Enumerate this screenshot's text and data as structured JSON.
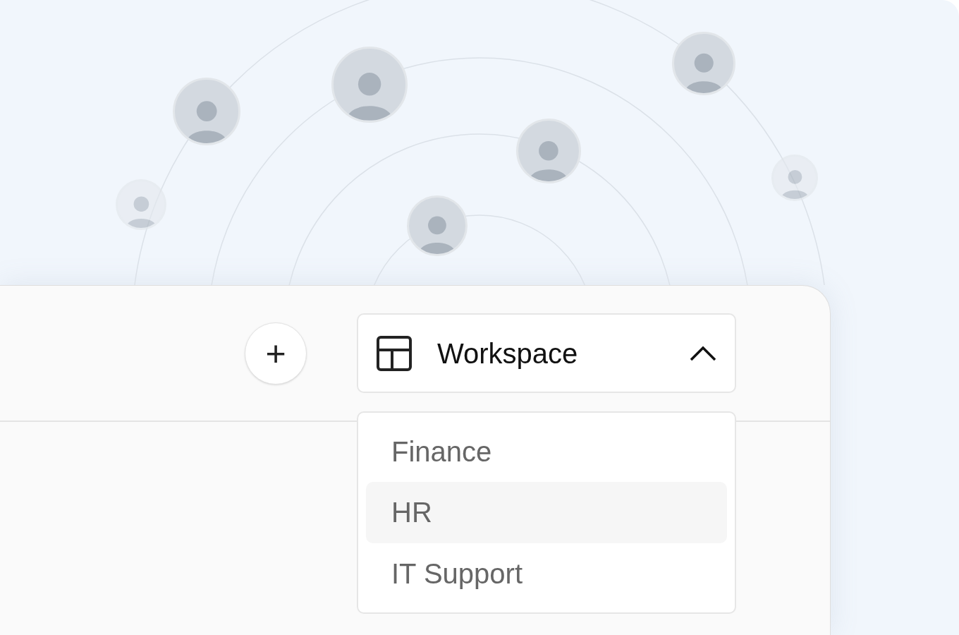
{
  "toolbar": {
    "add_button": {
      "label": "+"
    }
  },
  "workspace_dropdown": {
    "label": "Workspace",
    "expanded": true,
    "options": [
      {
        "label": "Finance",
        "selected": false
      },
      {
        "label": "HR",
        "selected": true
      },
      {
        "label": "IT Support",
        "selected": false
      }
    ]
  }
}
